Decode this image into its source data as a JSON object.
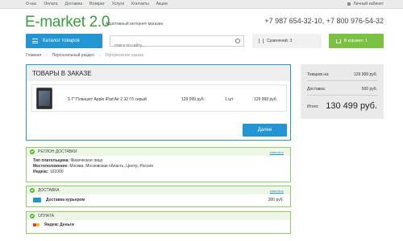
{
  "topnav": [
    "О нас",
    "Оплата",
    "Доставка",
    "Возврат",
    "Услуги",
    "Контакты",
    "Акции"
  ],
  "cabinet_label": "Личный кабинет",
  "logo": "E-market 2.0",
  "tagline": "Адаптивный интернет-магазин",
  "phones": "+7 987 654-32-10, +7 800 976-54-32",
  "catalog_label": "Каталог товаров",
  "search_placeholder": "поиск по сайту...",
  "compare_label": "Сравнений: 3",
  "cart_label": "В корзине: 1",
  "breadcrumb": [
    "Главная",
    "Персональный раздел",
    "Оформление заказа"
  ],
  "order": {
    "title": "ТОВАРЫ В ЗАКАЗЕ",
    "item": {
      "name": "9.7\" Планшет Apple iPad Air 2 32 Гб серый",
      "price": "129 999 руб.",
      "qty": "1 шт",
      "total": "129 999 руб."
    },
    "next_label": "Далее"
  },
  "summary": {
    "goods_label": "Товаров на:",
    "goods_value": "129 999 руб.",
    "delivery_label": "Доставка:",
    "delivery_value": "500 руб.",
    "total_label": "Итого:",
    "total_value": "130 499 руб."
  },
  "region": {
    "title": "РЕГИОН ДОСТАВКИ",
    "edit": "изменить",
    "payer_label": "Тип плательщика:",
    "payer_value": "Физическое лицо",
    "location_label": "Местоположение:",
    "location_value": "Москва, Московская область, Центр, Россия",
    "index_label": "Индекс:",
    "index_value": "101000"
  },
  "delivery": {
    "title": "ДОСТАВКА",
    "edit": "изменить",
    "method": "Доставка курьером",
    "price": "300 руб."
  },
  "payment": {
    "title": "ОПЛАТА",
    "method": "Яндекс Деньги"
  },
  "colors": {
    "accent_blue": "#2196d3",
    "accent_green": "#7bc142",
    "logo_green": "#3a9e3c"
  },
  "icons": [
    "lock-icon",
    "burger-icon",
    "search-icon",
    "compare-icon",
    "cart-icon",
    "check-icon",
    "truck-icon",
    "yandex-money-icon"
  ]
}
